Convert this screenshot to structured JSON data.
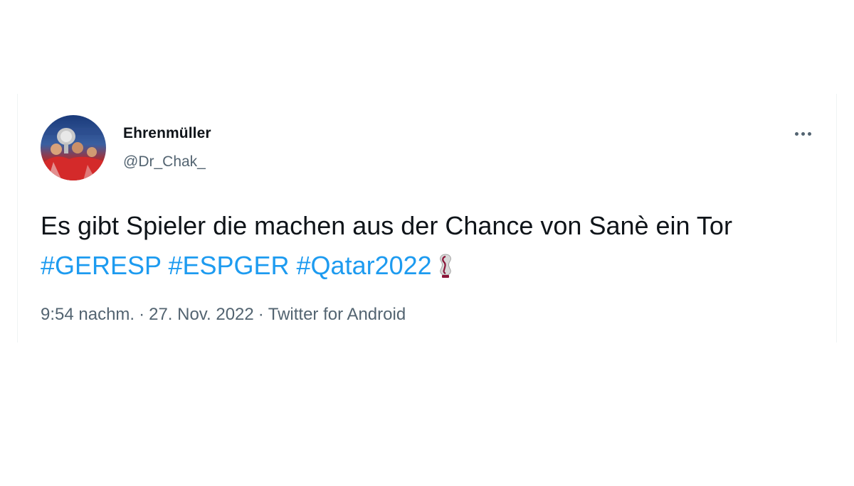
{
  "author": {
    "name": "Ehrenmüller",
    "handle": "@Dr_Chak_",
    "avatar_icon": "profile-photo-trophy-celebration"
  },
  "tweet": {
    "text": "Es gibt Spieler die machen aus der Chance von Sanè ein Tor",
    "hashtags": [
      "#GERESP",
      "#ESPGER",
      "#Qatar2022"
    ],
    "emoji_icon": "world-cup-trophy-icon"
  },
  "meta": {
    "time": "9:54 nachm.",
    "separator": "·",
    "date": "27. Nov. 2022",
    "source": "Twitter for Android"
  },
  "more_icon": "more-horizontal-icon",
  "colors": {
    "text": "#0f1419",
    "secondary": "#536471",
    "link": "#1d9bf0",
    "border": "#eff3f4"
  }
}
